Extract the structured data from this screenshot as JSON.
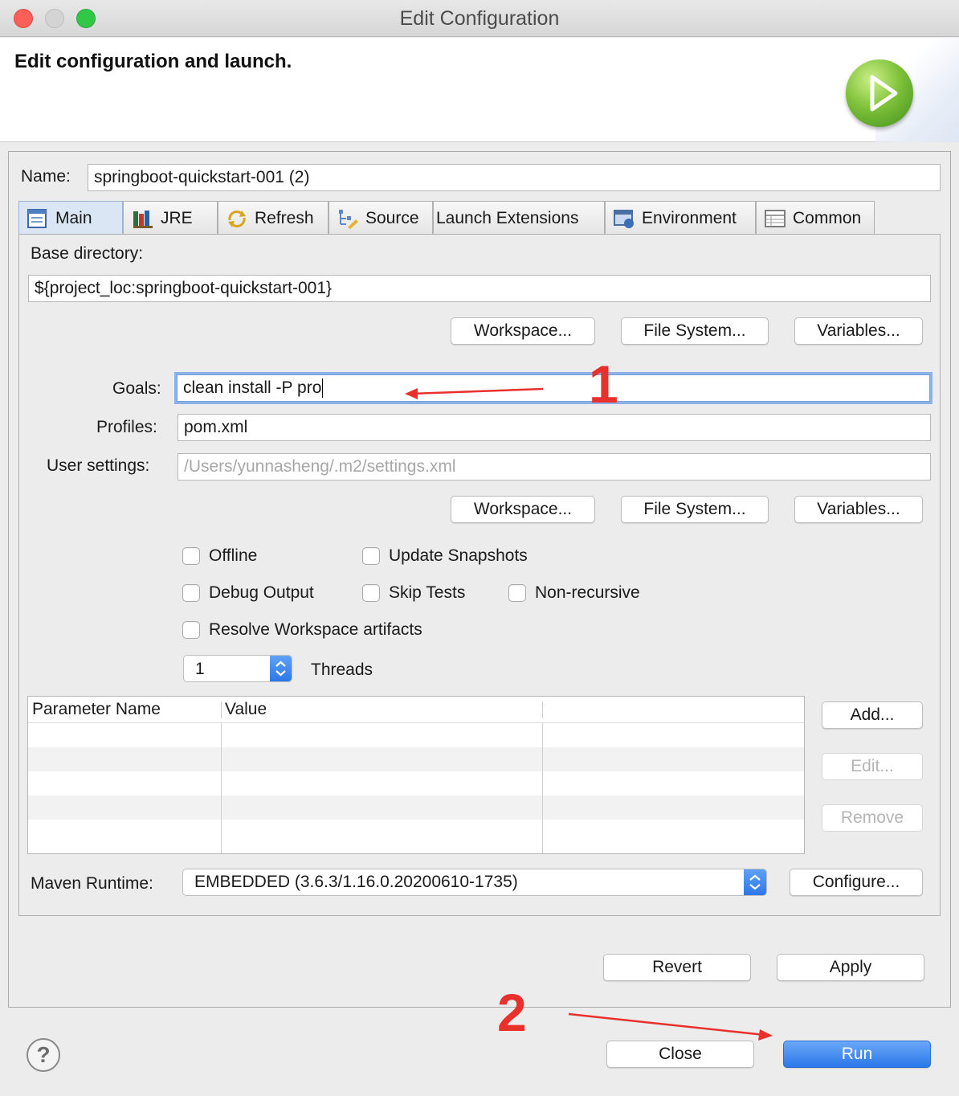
{
  "window": {
    "title": "Edit Configuration"
  },
  "banner": {
    "title": "Edit configuration and launch.",
    "icon": "run-launch-icon"
  },
  "name_field": {
    "label": "Name:",
    "value": "springboot-quickstart-001 (2)"
  },
  "tabs": [
    {
      "label": "Main",
      "icon": "main-tab-icon",
      "active": true
    },
    {
      "label": "JRE",
      "icon": "jre-books-icon",
      "active": false
    },
    {
      "label": "Refresh",
      "icon": "refresh-icon",
      "active": false
    },
    {
      "label": "Source",
      "icon": "source-icon",
      "active": false
    },
    {
      "label": "Launch Extensions",
      "icon": "",
      "active": false
    },
    {
      "label": "Environment",
      "icon": "environment-icon",
      "active": false
    },
    {
      "label": "Common",
      "icon": "common-icon",
      "active": false
    }
  ],
  "main": {
    "base_dir_label": "Base directory:",
    "base_dir_value": "${project_loc:springboot-quickstart-001}",
    "buttons_row1": [
      "Workspace...",
      "File System...",
      "Variables..."
    ],
    "goals_label": "Goals:",
    "goals_value": "clean install -P pro",
    "profiles_label": "Profiles:",
    "profiles_value": "pom.xml",
    "user_settings_label": "User settings:",
    "user_settings_placeholder": "/Users/yunnasheng/.m2/settings.xml",
    "buttons_row2": [
      "Workspace...",
      "File System...",
      "Variables..."
    ],
    "checkboxes": {
      "offline": "Offline",
      "update_snapshots": "Update Snapshots",
      "debug_output": "Debug Output",
      "skip_tests": "Skip Tests",
      "non_recursive": "Non-recursive",
      "resolve_workspace": "Resolve Workspace artifacts"
    },
    "threads_value": "1",
    "threads_label": "Threads",
    "params_table": {
      "columns": [
        "Parameter Name",
        "Value"
      ],
      "rows": []
    },
    "table_buttons": {
      "add": "Add...",
      "edit": "Edit...",
      "remove": "Remove"
    },
    "maven_runtime_label": "Maven Runtime:",
    "maven_runtime_value": "EMBEDDED (3.6.3/1.16.0.20200610-1735)",
    "configure_button": "Configure..."
  },
  "footer": {
    "revert": "Revert",
    "apply": "Apply",
    "close": "Close",
    "run": "Run",
    "help": "?"
  },
  "annotations": {
    "marker1": "1",
    "marker2": "2",
    "color": "#e8312c"
  },
  "colors": {
    "accent": "#2c78ea",
    "focus_ring": "#8ab1ea",
    "banner_icon_green": "#6ab52e"
  }
}
